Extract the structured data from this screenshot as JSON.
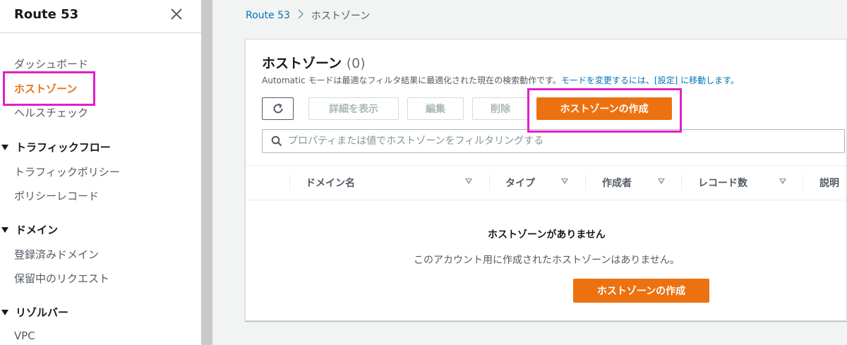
{
  "sidebar": {
    "title": "Route 53",
    "items": [
      {
        "label": "ダッシュボード"
      },
      {
        "label": "ホストゾーン"
      },
      {
        "label": "ヘルスチェック"
      }
    ],
    "groups": [
      {
        "label": "トラフィックフロー",
        "items": [
          "トラフィックポリシー",
          "ポリシーレコード"
        ]
      },
      {
        "label": "ドメイン",
        "items": [
          "登録済みドメイン",
          "保留中のリクエスト"
        ]
      },
      {
        "label": "リゾルバー",
        "items": [
          "VPC"
        ]
      }
    ]
  },
  "breadcrumb": {
    "root": "Route 53",
    "current": "ホストゾーン"
  },
  "panel": {
    "title": "ホストゾーン",
    "count": "(0)",
    "desc_prefix": "Automatic モードは最適なフィルタ結果に最適化された現在の検索動作です。",
    "desc_link": "モードを変更するには、[設定] に移動します。"
  },
  "toolbar": {
    "details_label": "詳細を表示",
    "edit_label": "編集",
    "delete_label": "削除",
    "create_label": "ホストゾーンの作成"
  },
  "filter": {
    "placeholder": "プロパティまたは値でホストゾーンをフィルタリングする"
  },
  "table": {
    "columns": [
      "ドメイン名",
      "タイプ",
      "作成者",
      "レコード数",
      "説明"
    ]
  },
  "empty_state": {
    "title": "ホストゾーンがありません",
    "description": "このアカウント用に作成されたホストゾーンはありません。",
    "button_label": "ホストゾーンの作成"
  },
  "colors": {
    "accent": "#ec7211",
    "link": "#0073bb",
    "highlight": "#e021c6"
  }
}
